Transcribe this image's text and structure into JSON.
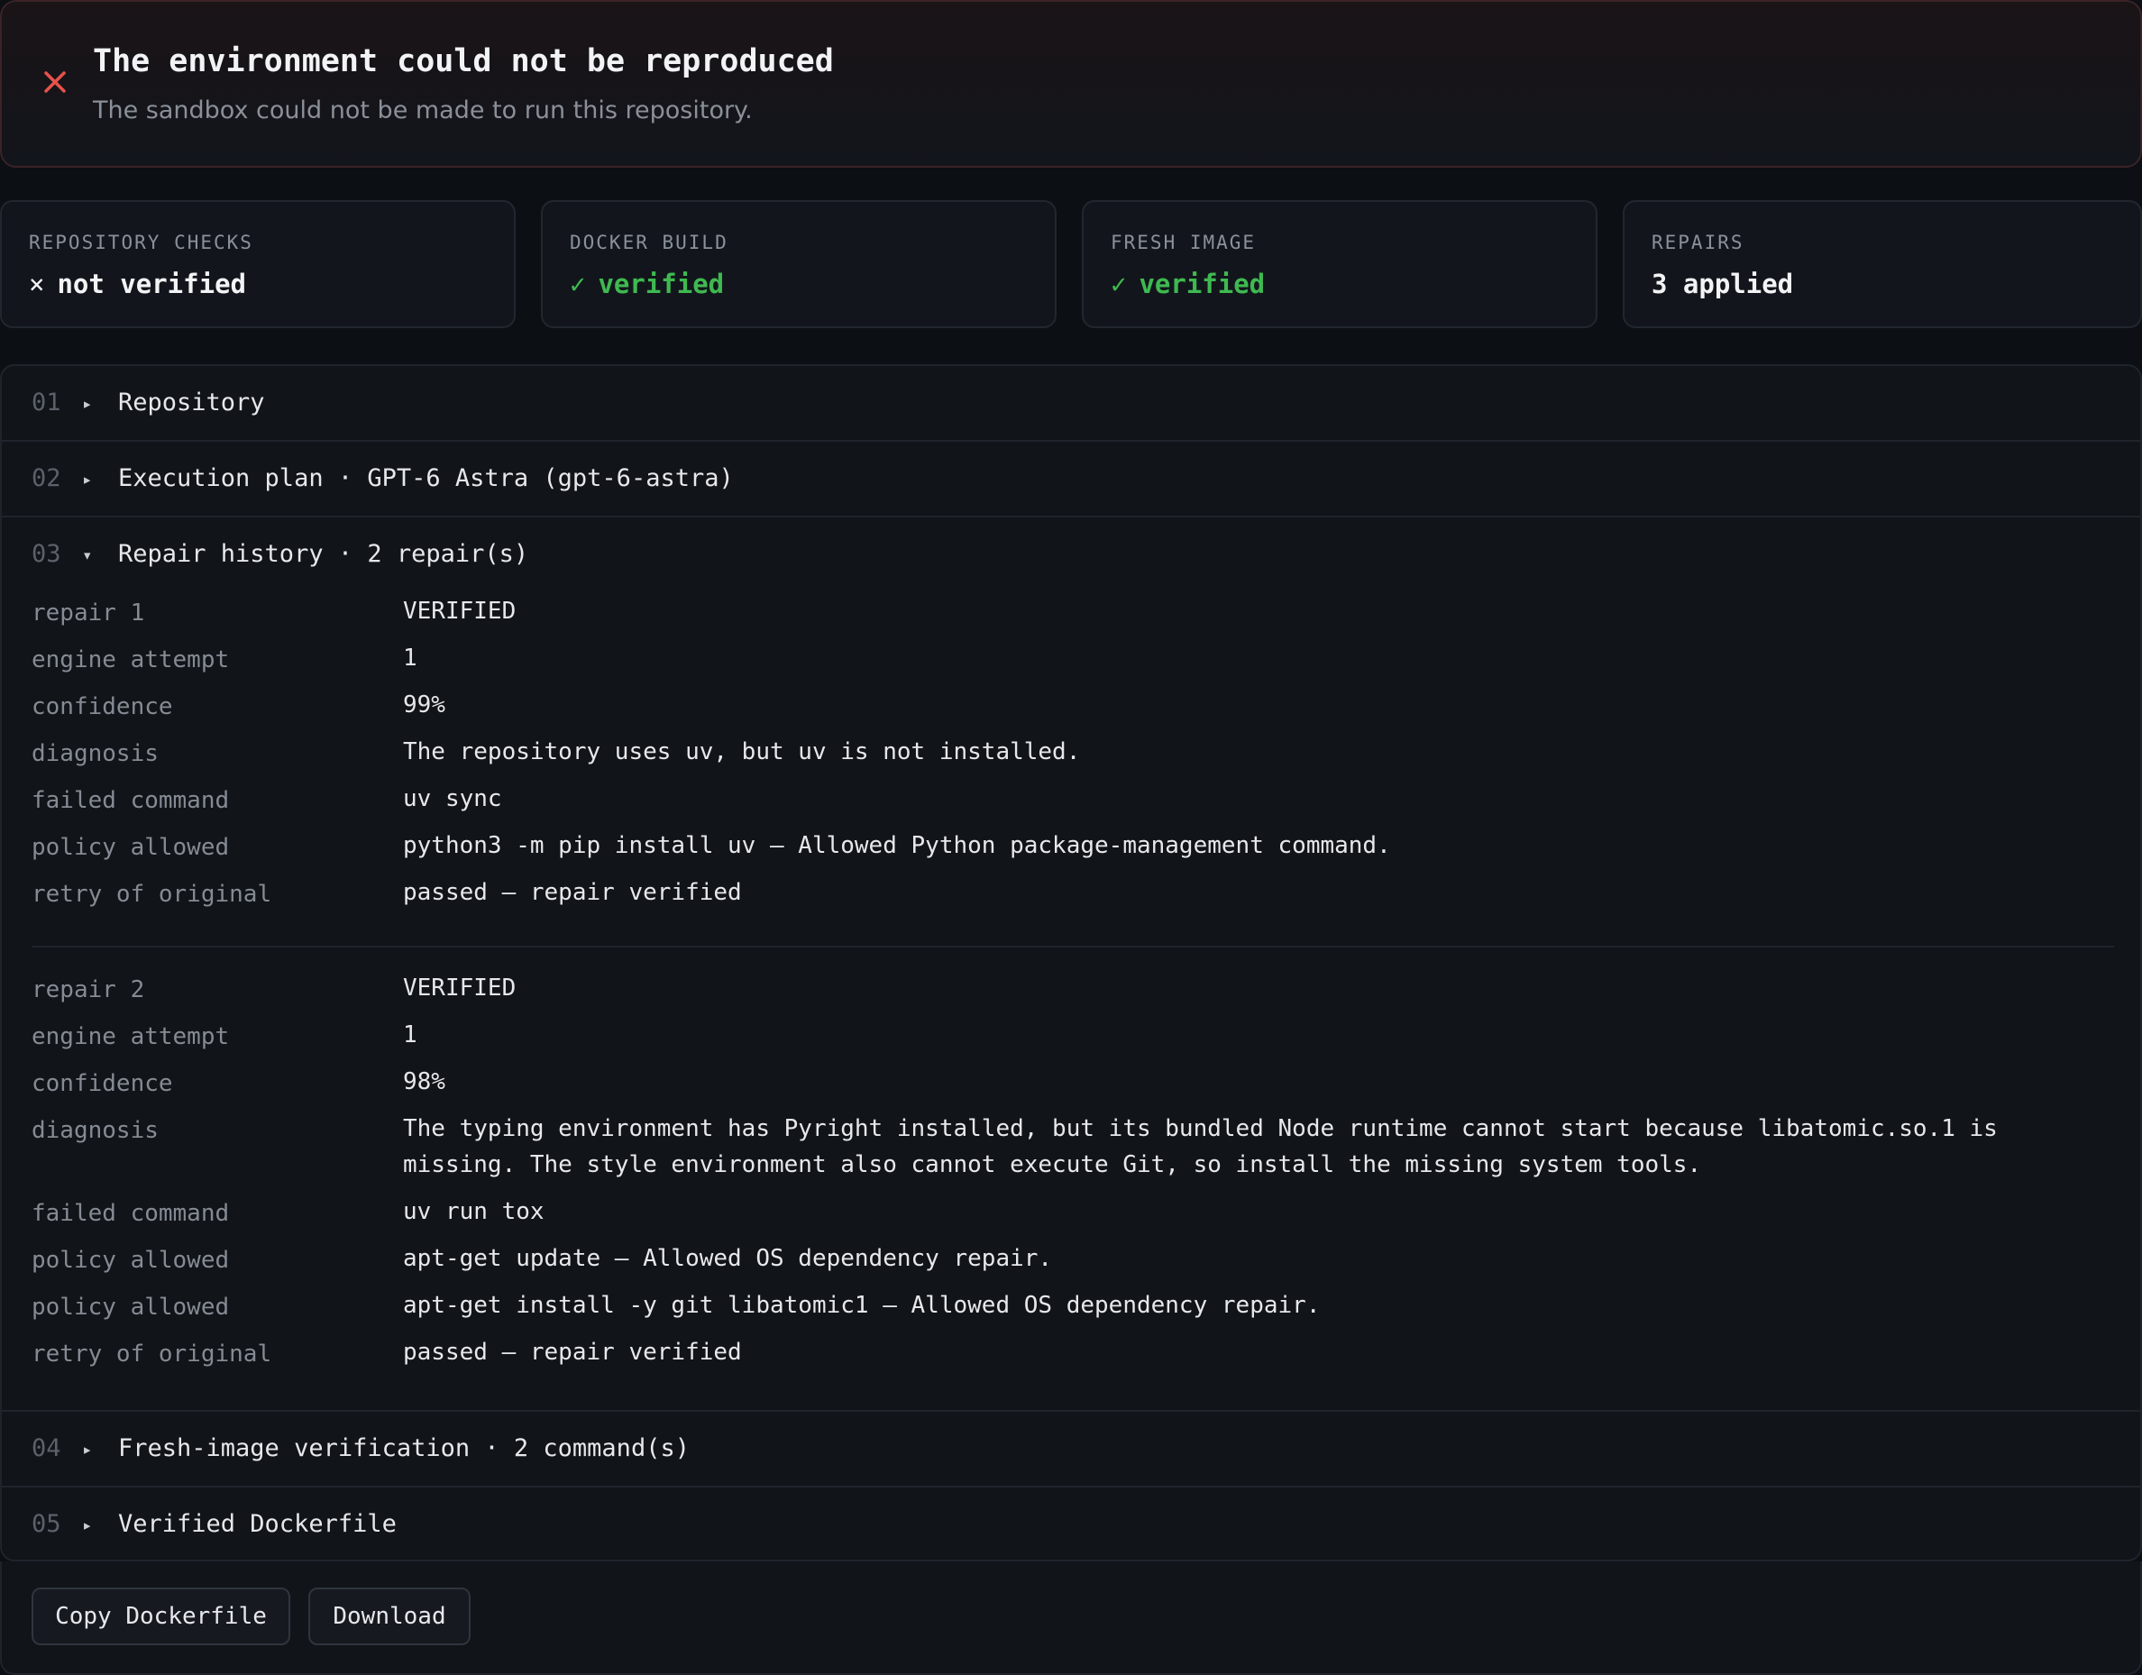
{
  "alert": {
    "icon": "close-icon",
    "color": "#e5534b",
    "title": "The environment could not be reproduced",
    "subtitle": "The sandbox could not be made to run this repository."
  },
  "status": [
    {
      "label": "REPOSITORY CHECKS",
      "mark": "×",
      "value": "not verified"
    },
    {
      "label": "DOCKER BUILD",
      "mark": "✓",
      "value": "verified"
    },
    {
      "label": "FRESH IMAGE",
      "mark": "✓",
      "value": "verified"
    },
    {
      "label": "REPAIRS",
      "mark": "",
      "value": "3 applied"
    }
  ],
  "colors": {
    "ok": "#3fb950",
    "error": "#e5534b"
  },
  "sections": [
    {
      "num": "01",
      "caret": "▸",
      "title": "Repository"
    },
    {
      "num": "02",
      "caret": "▸",
      "title": "Execution plan · GPT-6 Astra (gpt-6-astra)"
    },
    {
      "num": "03",
      "caret": "▾",
      "title": "Repair history · 2 repair(s)"
    },
    {
      "num": "04",
      "caret": "▸",
      "title": "Fresh-image verification · 2 command(s)"
    },
    {
      "num": "05",
      "caret": "▸",
      "title": "Verified Dockerfile"
    }
  ],
  "repairs": [
    {
      "rows": [
        {
          "key": "repair 1",
          "value": "VERIFIED"
        },
        {
          "key": "engine attempt",
          "value": "1"
        },
        {
          "key": "confidence",
          "value": "99%"
        },
        {
          "key": "diagnosis",
          "value": "The repository uses uv, but uv is not installed."
        },
        {
          "key": "failed command",
          "value": "uv sync"
        },
        {
          "key": "policy allowed",
          "value": "python3 -m pip install uv — Allowed Python package-management command."
        },
        {
          "key": "retry of original",
          "value": "passed — repair verified"
        }
      ]
    },
    {
      "rows": [
        {
          "key": "repair 2",
          "value": "VERIFIED"
        },
        {
          "key": "engine attempt",
          "value": "1"
        },
        {
          "key": "confidence",
          "value": "98%"
        },
        {
          "key": "diagnosis",
          "value": "The typing environment has Pyright installed, but its bundled Node runtime cannot start because libatomic.so.1 is missing. The style environment also cannot execute Git, so install the missing system tools."
        },
        {
          "key": "failed command",
          "value": "uv run tox"
        },
        {
          "key": "policy allowed",
          "value": "apt-get update — Allowed OS dependency repair."
        },
        {
          "key": "policy allowed",
          "value": "apt-get install -y git libatomic1 — Allowed OS dependency repair."
        },
        {
          "key": "retry of original",
          "value": "passed — repair verified"
        }
      ]
    }
  ],
  "footer": {
    "copy_label": "Copy Dockerfile",
    "download_label": "Download"
  }
}
